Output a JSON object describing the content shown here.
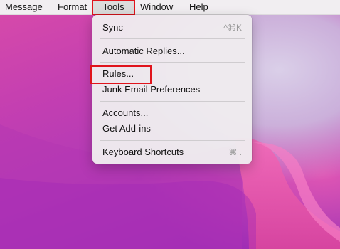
{
  "menubar": {
    "items": [
      {
        "label": "Message"
      },
      {
        "label": "Format"
      },
      {
        "label": "Tools"
      },
      {
        "label": "Window"
      },
      {
        "label": "Help"
      }
    ]
  },
  "tools_menu": {
    "items": [
      {
        "label": "Sync",
        "shortcut": "^⌘K"
      },
      {
        "label": "Automatic Replies..."
      },
      {
        "label": "Rules..."
      },
      {
        "label": "Junk Email Preferences"
      },
      {
        "label": "Accounts..."
      },
      {
        "label": "Get Add-ins"
      },
      {
        "label": "Keyboard Shortcuts",
        "shortcut": "⌘ ."
      }
    ]
  },
  "colors": {
    "highlight": "#e0141c",
    "menubar_bg": "#f1eef1",
    "menu_bg": "#eeebee"
  }
}
